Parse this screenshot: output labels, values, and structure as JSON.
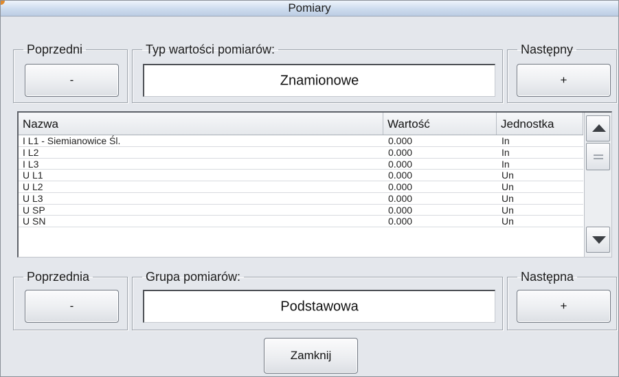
{
  "window": {
    "title": "Pomiary"
  },
  "measurement_type": {
    "prev_legend": "Poprzedni",
    "prev_button": "-",
    "type_legend": "Typ wartości pomiarów:",
    "type_value": "Znamionowe",
    "next_legend": "Następny",
    "next_button": "+"
  },
  "table": {
    "columns": [
      "Nazwa",
      "Wartość",
      "Jednostka"
    ],
    "rows": [
      {
        "name": "I L1 - Siemianowice Śl.",
        "value": "0.000",
        "unit": "In"
      },
      {
        "name": "I L2",
        "value": "0.000",
        "unit": "In"
      },
      {
        "name": "I L3",
        "value": "0.000",
        "unit": "In"
      },
      {
        "name": "U L1",
        "value": "0.000",
        "unit": "Un"
      },
      {
        "name": "U L2",
        "value": "0.000",
        "unit": "Un"
      },
      {
        "name": "U L3",
        "value": "0.000",
        "unit": "Un"
      },
      {
        "name": "U SP",
        "value": "0.000",
        "unit": "Un"
      },
      {
        "name": "U SN",
        "value": "0.000",
        "unit": "Un"
      }
    ]
  },
  "measurement_group": {
    "prev_legend": "Poprzednia",
    "prev_button": "-",
    "group_legend": "Grupa pomiarów:",
    "group_value": "Podstawowa",
    "next_legend": "Następna",
    "next_button": "+"
  },
  "footer": {
    "close_button": "Zamknij"
  }
}
